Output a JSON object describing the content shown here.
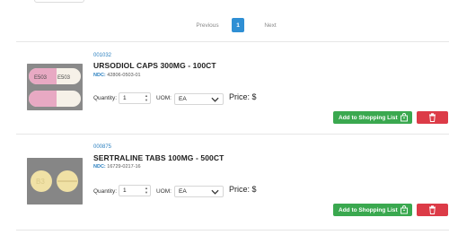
{
  "pagination": {
    "previous_label": "Previous",
    "current_page": "1",
    "next_label": "Next"
  },
  "products": [
    {
      "sku": "001032",
      "title": "URSODIOL CAPS 300MG - 100CT",
      "ndc_label": "NDC:",
      "ndc_value": "42806-0503-01",
      "image_imprint_left": "E503",
      "image_imprint_right": "E503",
      "quantity_label": "Quantity:",
      "quantity_value": "1",
      "uom_label": "UOM:",
      "uom_value": "EA",
      "price_label": "Price: $",
      "add_button_label": "Add to Shopping List"
    },
    {
      "sku": "000875",
      "title": "SERTRALINE TABS 100MG - 500CT",
      "ndc_label": "NDC:",
      "ndc_value": "16729-0217-16",
      "image_imprint_left": "B3",
      "quantity_label": "Quantity:",
      "quantity_value": "1",
      "uom_label": "UOM:",
      "uom_value": "EA",
      "price_label": "Price: $",
      "add_button_label": "Add to Shopping List"
    }
  ],
  "colors": {
    "accent_blue": "#2f8fd4",
    "add_green": "#3aa84f",
    "delete_red": "#dc3b47"
  }
}
